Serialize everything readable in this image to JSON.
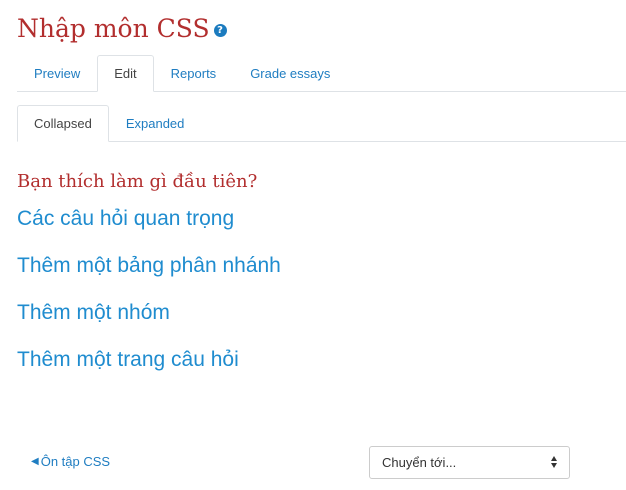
{
  "page": {
    "title": "Nhập môn CSS",
    "help_icon": "question-circle-icon"
  },
  "primary_tabs": [
    {
      "label": "Preview",
      "active": false
    },
    {
      "label": "Edit",
      "active": true
    },
    {
      "label": "Reports",
      "active": false
    },
    {
      "label": "Grade essays",
      "active": false
    }
  ],
  "secondary_tabs": [
    {
      "label": "Collapsed",
      "active": true
    },
    {
      "label": "Expanded",
      "active": false
    }
  ],
  "main": {
    "question": "Bạn thích làm gì đầu tiên?",
    "options": [
      "Các câu hỏi quan trọng",
      "Thêm một bảng phân nhánh",
      "Thêm một nhóm",
      "Thêm một trang câu hỏi"
    ]
  },
  "footer": {
    "prev_link": "Ôn tập CSS",
    "jump_select": {
      "selected": "Chuyển tới..."
    }
  },
  "colors": {
    "heading": "#b22e2e",
    "link": "#1f8ccf",
    "help_icon_bg": "#1b7bbf"
  }
}
